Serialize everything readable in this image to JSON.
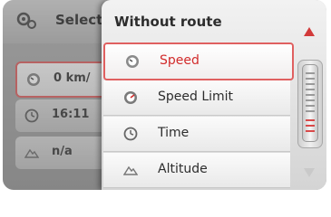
{
  "background": {
    "title": "Select",
    "icon": "settings-gear-icon",
    "rows": [
      {
        "icon": "speedometer-icon",
        "value": "0 km/"
      },
      {
        "icon": "clock-icon",
        "value": "16:11"
      },
      {
        "icon": "mountain-icon",
        "value": "n/a"
      }
    ]
  },
  "popup": {
    "title": "Without route",
    "items": [
      {
        "label": "Speed",
        "icon": "speedometer-icon",
        "selected": true
      },
      {
        "label": "Speed Limit",
        "icon": "speed-limit-icon",
        "selected": false
      },
      {
        "label": "Time",
        "icon": "clock-icon",
        "selected": false
      },
      {
        "label": "Altitude",
        "icon": "mountain-icon",
        "selected": false
      }
    ]
  },
  "scrollbar": {
    "up_icon": "arrow-up-icon",
    "down_icon": "arrow-down-icon",
    "position": 0
  },
  "colors": {
    "accent": "#d22b2b",
    "selection_border": "#e06060"
  }
}
